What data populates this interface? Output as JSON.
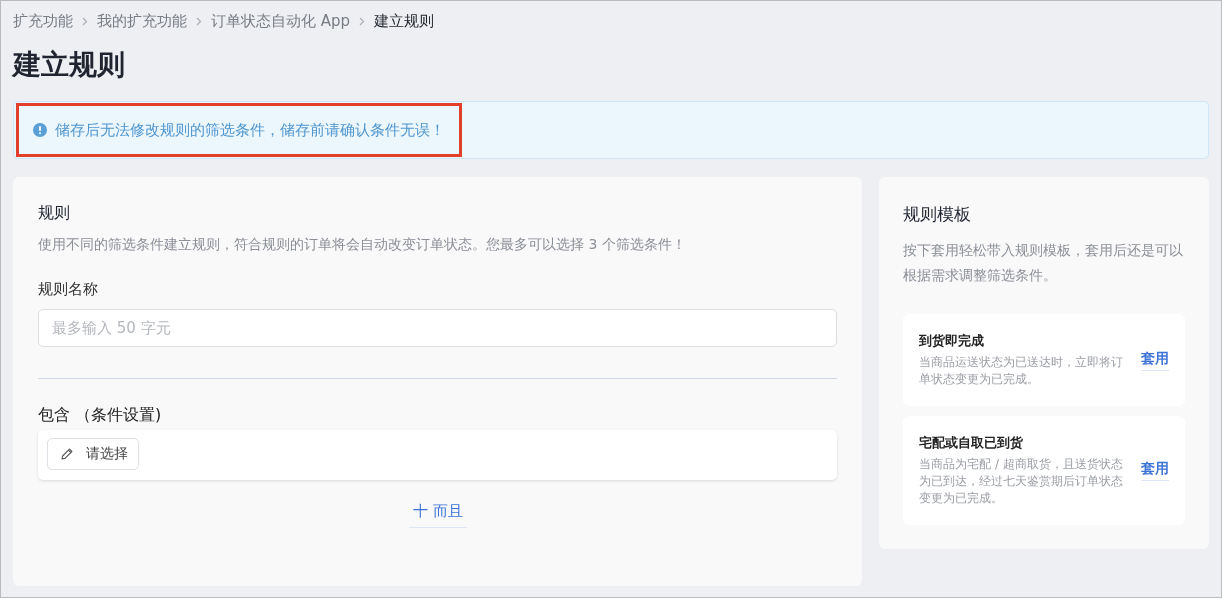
{
  "breadcrumb": [
    {
      "label": "扩充功能",
      "current": false
    },
    {
      "label": "我的扩充功能",
      "current": false
    },
    {
      "label": "订单状态自动化 App",
      "current": false
    },
    {
      "label": "建立规则",
      "current": true
    }
  ],
  "page_title": "建立规则",
  "alert": {
    "text": "储存后无法修改规则的筛选条件，储存前请确认条件无误！",
    "highlighted": true
  },
  "rule_panel": {
    "title": "规则",
    "description": "使用不同的筛选条件建立规则，符合规则的订单将会自动改变订单状态。您最多可以选择 3 个筛选条件！",
    "name_label": "规则名称",
    "name_field": {
      "placeholder": "最多输入 50 字元"
    },
    "condition_label": "包含 （条件设置)",
    "select_button": "请选择",
    "and_link": "十 而且"
  },
  "template_panel": {
    "title": "规则模板",
    "description": "按下套用轻松带入规则模板，套用后还是可以根据需求调整筛选条件。",
    "templates": [
      {
        "title": "到货即完成",
        "description": "当商品运送状态为已送达时，立即将订单状态变更为已完成。",
        "action": "套用"
      },
      {
        "title": "宅配或自取已到货",
        "description": "当商品为宅配 / 超商取货，且送货状态为已到达，经过七天鉴赏期后订单状态变更为已完成。",
        "action": "套用"
      }
    ]
  }
}
